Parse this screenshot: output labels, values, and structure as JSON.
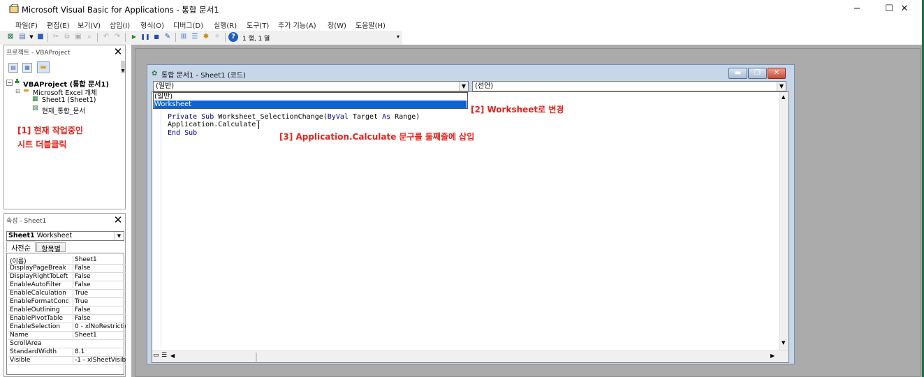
{
  "window": {
    "title": "Microsoft Visual Basic for Applications - 통합 문서1",
    "minimize": "−",
    "maximize": "☐",
    "close": "✕"
  },
  "menu": [
    "파일(F)",
    "편집(E)",
    "보기(V)",
    "삽입(I)",
    "형식(O)",
    "디버그(D)",
    "실행(R)",
    "도구(T)",
    "추가 기능(A)",
    "창(W)",
    "도움말(H)"
  ],
  "toolbar": {
    "position": "1 행, 1 열"
  },
  "project": {
    "title": "프로젝트 - VBAProject",
    "close": "✕",
    "root": "VBAProject (통합 문서1)",
    "folder": "Microsoft Excel 개체",
    "sheet": "Sheet1 (Sheet1)",
    "workbook": "현재_통합_문서"
  },
  "properties": {
    "title": "속성 - Sheet1",
    "close": "✕",
    "object_name": "Sheet1",
    "object_type": "Worksheet",
    "tab_alpha": "사전순",
    "tab_category": "항목별",
    "rows": [
      [
        "(이름)",
        "Sheet1"
      ],
      [
        "DisplayPageBreak",
        "False"
      ],
      [
        "DisplayRightToLeft",
        "False"
      ],
      [
        "EnableAutoFilter",
        "False"
      ],
      [
        "EnableCalculation",
        "True"
      ],
      [
        "EnableFormatCond",
        "True"
      ],
      [
        "EnableOutlining",
        "False"
      ],
      [
        "EnablePivotTable",
        "False"
      ],
      [
        "EnableSelection",
        "0 - xlNoRestrictio"
      ],
      [
        "Name",
        "Sheet1"
      ],
      [
        "ScrollArea",
        ""
      ],
      [
        "StandardWidth",
        "8.1"
      ],
      [
        "Visible",
        "-1 - xlSheetVisib"
      ]
    ]
  },
  "code_window": {
    "title": "통합 문서1 - Sheet1 (코드)",
    "object_combo": "(일반)",
    "proc_combo": "(선언)",
    "dropdown": [
      "(일반)",
      "Worksheet"
    ],
    "lines": [
      "Private Sub Worksheet_SelectionChange(ByVal Target As Range)",
      "Application.Calculate",
      "End Sub"
    ]
  },
  "annotations": {
    "a1_line1": "[1] 현재 작업중인",
    "a1_line2": "시트 더블클릭",
    "a2": "[2] Worksheet로 변경",
    "a3": "[3] Application.Calculate 문구를 둘째줄에 삽입"
  },
  "colors": {
    "annotation": "#e2231a",
    "selection": "#0a64d4",
    "keyword": "#00007f",
    "excel_green": "#1e7145"
  }
}
